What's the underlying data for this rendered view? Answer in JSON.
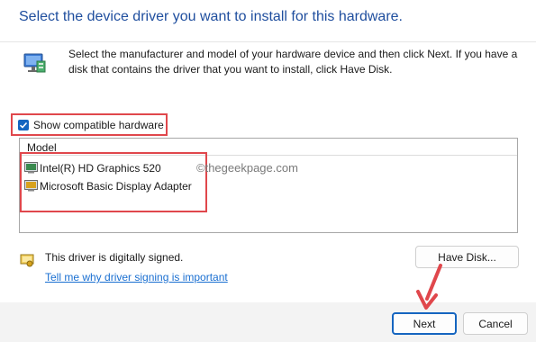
{
  "header": {
    "title": "Select the device driver you want to install for this hardware."
  },
  "description": "Select the manufacturer and model of your hardware device and then click Next. If you have a disk that contains the driver that you want to install, click Have Disk.",
  "compatible_checkbox": {
    "label": "Show compatible hardware",
    "checked": true
  },
  "model_list": {
    "column_header": "Model",
    "items": [
      {
        "label": "Intel(R) HD Graphics 520",
        "icon": "display-adapter-icon"
      },
      {
        "label": "Microsoft Basic Display Adapter",
        "icon": "display-adapter-icon"
      }
    ]
  },
  "watermark": "©thegeekpage.com",
  "signing": {
    "status": "This driver is digitally signed.",
    "link": "Tell me why driver signing is important"
  },
  "buttons": {
    "have_disk": "Have Disk...",
    "next": "Next",
    "cancel": "Cancel"
  },
  "colors": {
    "accent": "#1565c0",
    "title": "#1f4e9e",
    "link": "#1a6fd1",
    "highlight": "#e0474c"
  }
}
